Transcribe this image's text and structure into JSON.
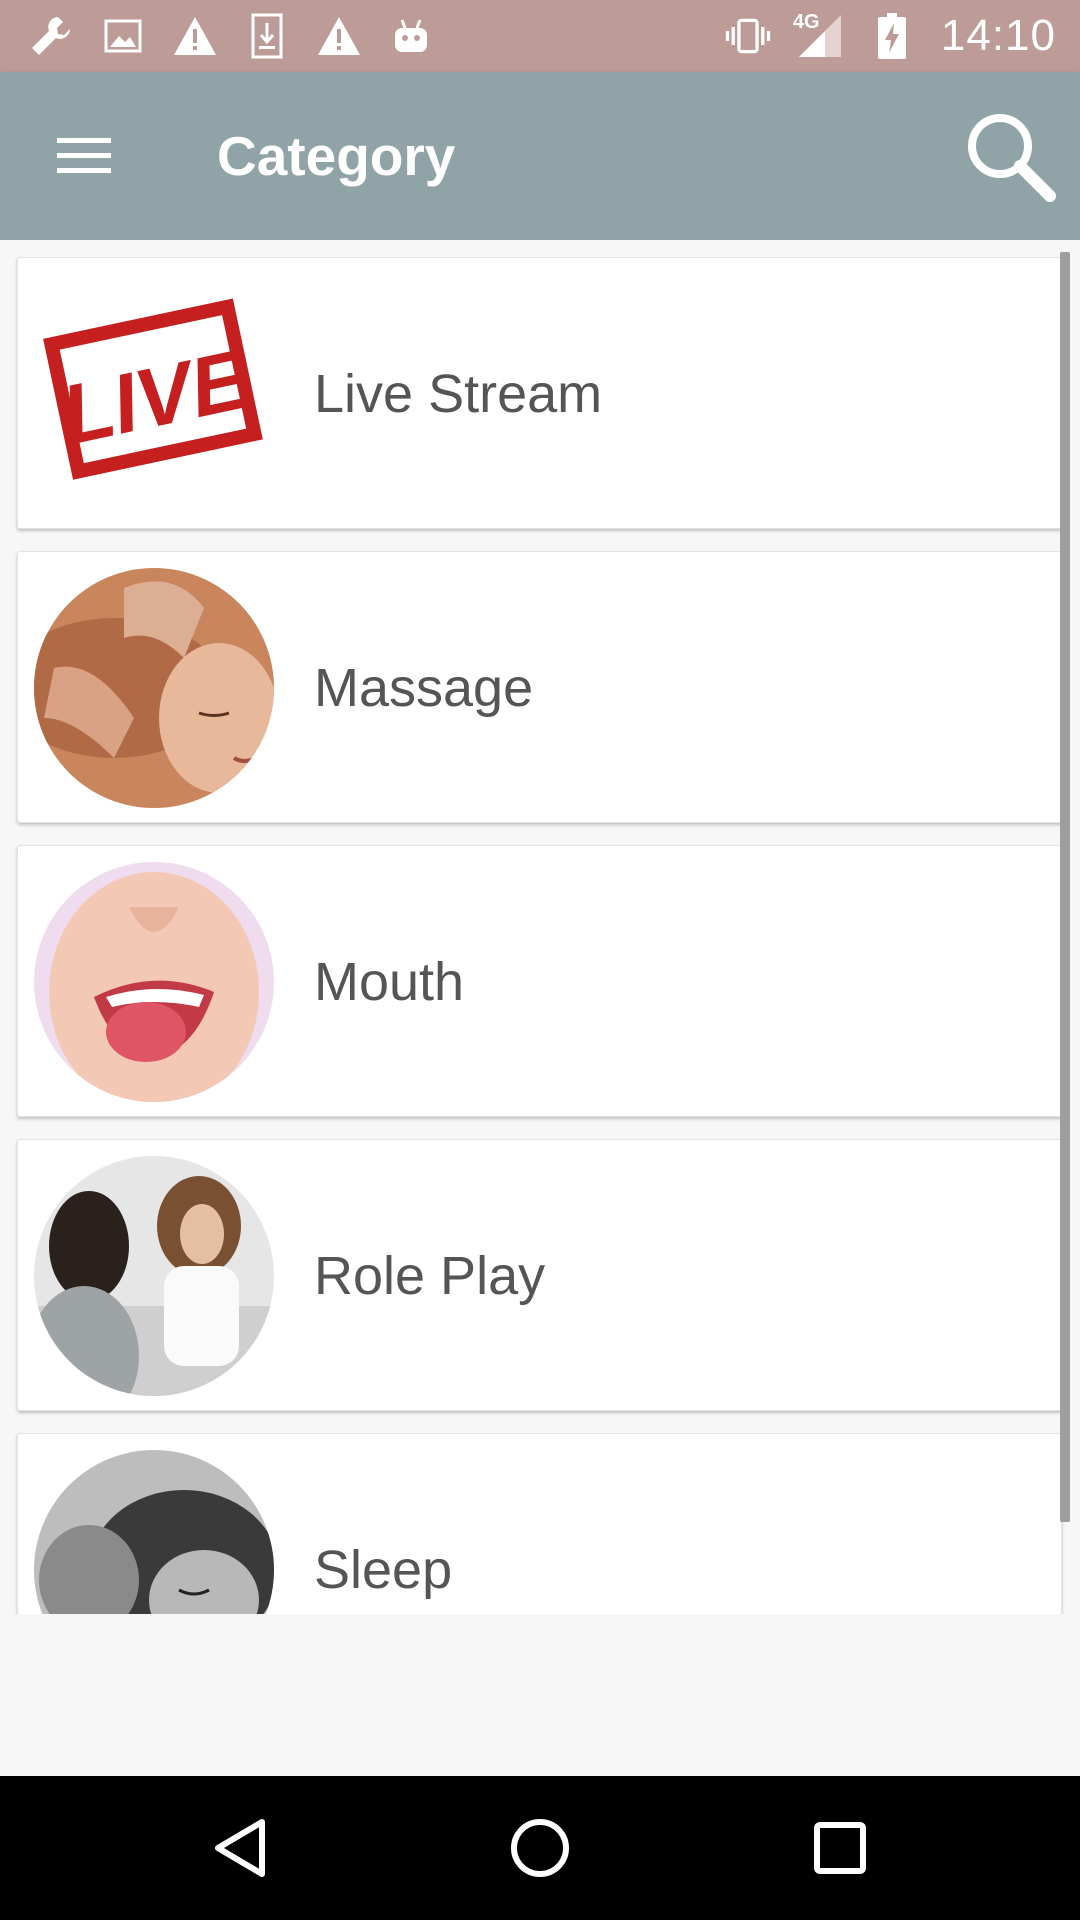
{
  "status_bar": {
    "time": "14:10",
    "network": "4G",
    "left_icons": [
      "wrench-icon",
      "image-icon",
      "warning-icon",
      "download-icon",
      "warning-icon",
      "android-icon"
    ],
    "right_icons": [
      "vibrate-icon",
      "signal-icon",
      "battery-charging-icon"
    ]
  },
  "toolbar": {
    "title": "Category",
    "menu_icon": "hamburger-menu-icon",
    "search_icon": "search-icon"
  },
  "categories": [
    {
      "label": "Live Stream",
      "thumb": "live-stamp-image"
    },
    {
      "label": "Massage",
      "thumb": "massage-photo"
    },
    {
      "label": "Mouth",
      "thumb": "mouth-photo"
    },
    {
      "label": "Role Play",
      "thumb": "role-play-photo"
    },
    {
      "label": "Sleep",
      "thumb": "sleep-photo"
    }
  ],
  "nav_bar": {
    "back_icon": "back-triangle-icon",
    "home_icon": "home-circle-icon",
    "recents_icon": "recents-square-icon"
  },
  "colors": {
    "status_bar": "#bd9c97",
    "toolbar": "#90a4a8",
    "label_text": "#555555"
  }
}
